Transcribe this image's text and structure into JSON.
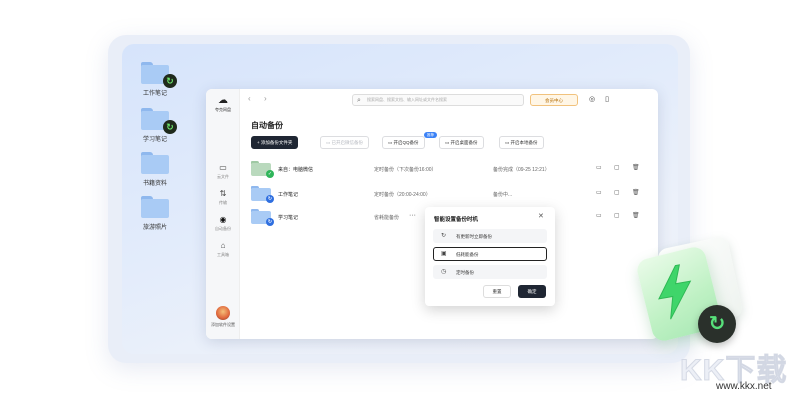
{
  "desktop": {
    "icons": [
      {
        "label": "工作笔记",
        "synced": true
      },
      {
        "label": "学习笔记",
        "synced": true
      },
      {
        "label": "书籍资料",
        "synced": false
      },
      {
        "label": "旅游照片",
        "synced": false
      }
    ]
  },
  "app": {
    "logo_text": "夸克网盘",
    "sidebar": [
      {
        "label": "云文件",
        "icon": "folder-icon"
      },
      {
        "label": "传输",
        "icon": "transfer-icon"
      },
      {
        "label": "自动备份",
        "icon": "backup-eye-icon",
        "active": true
      },
      {
        "label": "工具箱",
        "icon": "toolbox-icon"
      }
    ],
    "add_device_label": "添加软件设置",
    "search_placeholder": "搜索网盘、搜索文档、输入网址或文件名搜索",
    "member_label": "会员中心",
    "title": "自动备份",
    "toolbar": {
      "add_folder": "添加备份文件夹",
      "sync_wechat": "已开启微信备份",
      "qq_backup": "开启QQ备份",
      "qq_badge": "推荐",
      "desktop_backup": "开启桌面备份",
      "local_backup": "开启本地备份"
    },
    "rows": [
      {
        "name": "来自：电脑微信",
        "schedule": "定时备份（下次备份16:00）",
        "status": "备份完成（09-25 12:21）",
        "folder": "green",
        "badge": "ok"
      },
      {
        "name": "工作笔记",
        "schedule": "定时备份（20:00-24:00）",
        "status": "备份中...",
        "folder": "blue",
        "badge": "sync"
      },
      {
        "name": "学习笔记",
        "schedule": "省耗能备份",
        "status": "",
        "folder": "blue",
        "badge": "sync"
      }
    ]
  },
  "popup": {
    "title": "智能设置备份时机",
    "options": [
      {
        "label": "有更新时立即备份",
        "icon": "refresh-icon",
        "selected": false
      },
      {
        "label": "低耗能备份",
        "icon": "battery-icon",
        "selected": true
      },
      {
        "label": "定时备份",
        "icon": "clock-icon",
        "selected": false
      }
    ],
    "reset_label": "重置",
    "ok_label": "确定"
  },
  "watermark": {
    "main": "KK下载",
    "url": "www.kkx.net"
  },
  "colors": {
    "accent_dark": "#1f2633",
    "sync_green": "#57e07a",
    "folder_blue": "#a9cbf5",
    "member_orange": "#b46b00"
  }
}
